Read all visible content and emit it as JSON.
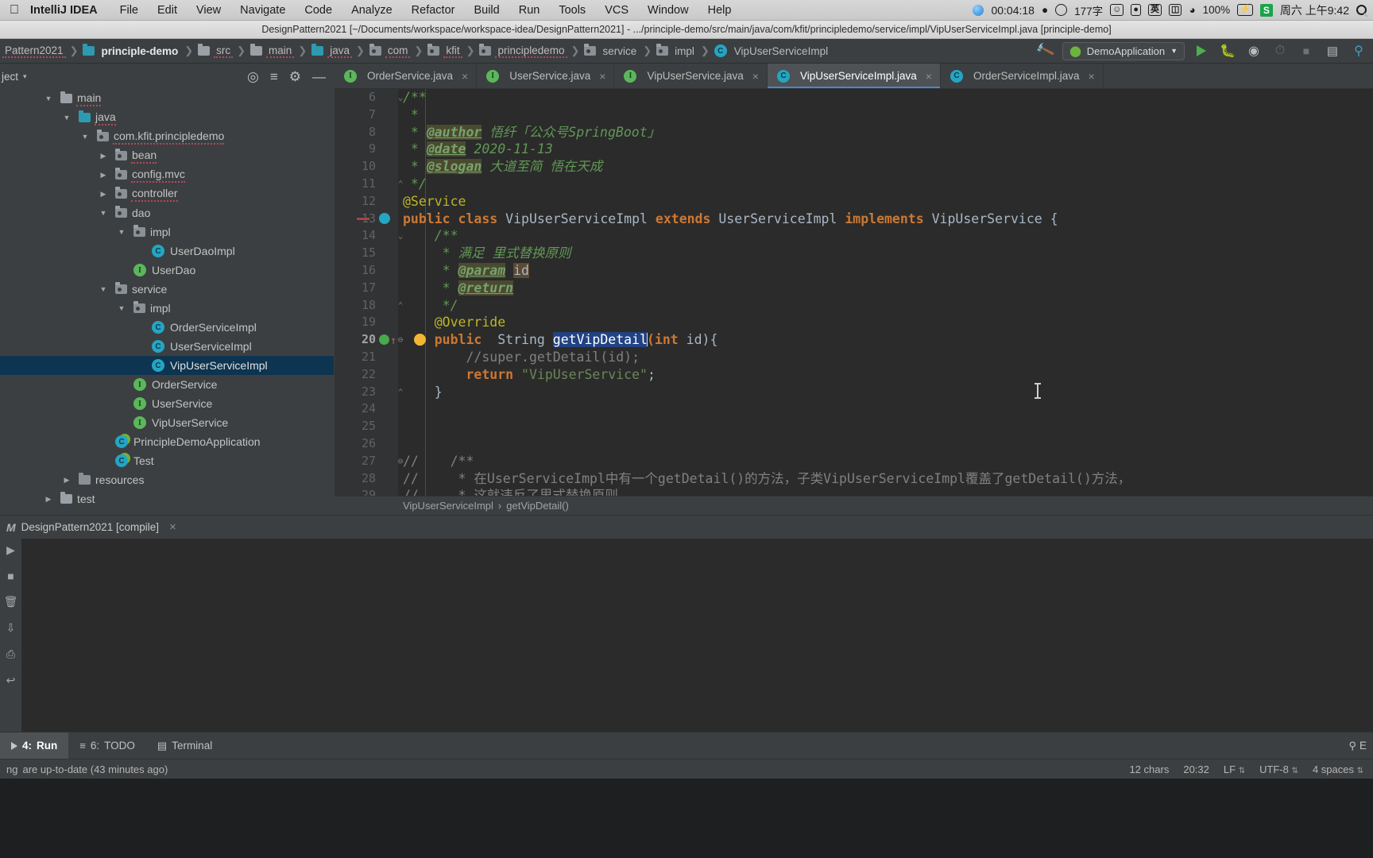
{
  "macbar": {
    "apple_glyph": "●",
    "app_name": "IntelliJ IDEA",
    "menus": [
      "File",
      "Edit",
      "View",
      "Navigate",
      "Code",
      "Analyze",
      "Refactor",
      "Build",
      "Run",
      "Tools",
      "VCS",
      "Window",
      "Help"
    ],
    "status_items": {
      "timer": "00:04:18",
      "char_count": "177字",
      "input_method": "英",
      "battery_percent": "100%",
      "clock": "周六 上午9:42",
      "shadowsocks": "S",
      "search_icon": "search-icon"
    }
  },
  "ide_title": "DesignPattern2021 [~/Documents/workspace/workspace-idea/DesignPattern2021] - .../principle-demo/src/main/java/com/kfit/principledemo/service/impl/VipUserServiceImpl.java [principle-demo]",
  "navbar": {
    "crumbs": [
      {
        "label": "Pattern2021",
        "icon": "none",
        "bold": false
      },
      {
        "label": "principle-demo",
        "icon": "module",
        "bold": true
      },
      {
        "label": "src",
        "icon": "folder",
        "bold": false
      },
      {
        "label": "main",
        "icon": "folder",
        "bold": false
      },
      {
        "label": "java",
        "icon": "folder-source",
        "bold": false
      },
      {
        "label": "com",
        "icon": "package",
        "bold": false
      },
      {
        "label": "kfit",
        "icon": "package",
        "bold": false
      },
      {
        "label": "principledemo",
        "icon": "package",
        "bold": false
      },
      {
        "label": "service",
        "icon": "package",
        "bold": false
      },
      {
        "label": "impl",
        "icon": "package",
        "bold": false
      },
      {
        "label": "VipUserServiceImpl",
        "icon": "class",
        "bold": false
      }
    ],
    "build_icon": "hammer-icon",
    "run_config": "DemoApplication",
    "run_config_caret": "▼",
    "buttons": [
      "run-icon",
      "debug-icon",
      "run-coverage-icon",
      "profiler-icon",
      "stop-icon",
      "layout-icon",
      "search-everywhere-icon"
    ]
  },
  "toolwindow": {
    "title": "ject",
    "caret": "▾",
    "icons": [
      "locate-icon",
      "collapse-all-icon",
      "settings-gear-icon",
      "hide-icon"
    ]
  },
  "tree": [
    {
      "label": "main",
      "depth": 2,
      "arrow": "▼",
      "icon": "folder",
      "selected": false,
      "squiggle": true
    },
    {
      "label": "java",
      "depth": 3,
      "arrow": "▼",
      "icon": "folder-source",
      "selected": false,
      "squiggle": true
    },
    {
      "label": "com.kfit.principledemo",
      "depth": 4,
      "arrow": "▼",
      "icon": "package",
      "selected": false,
      "squiggle": true
    },
    {
      "label": "bean",
      "depth": 5,
      "arrow": "▶",
      "icon": "package",
      "selected": false,
      "squiggle": true
    },
    {
      "label": "config.mvc",
      "depth": 5,
      "arrow": "▶",
      "icon": "package",
      "selected": false,
      "squiggle": true
    },
    {
      "label": "controller",
      "depth": 5,
      "arrow": "▶",
      "icon": "package",
      "selected": false,
      "squiggle": true
    },
    {
      "label": "dao",
      "depth": 5,
      "arrow": "▼",
      "icon": "package",
      "selected": false,
      "squiggle": false
    },
    {
      "label": "impl",
      "depth": 6,
      "arrow": "▼",
      "icon": "package",
      "selected": false,
      "squiggle": false
    },
    {
      "label": "UserDaoImpl",
      "depth": 7,
      "arrow": "",
      "icon": "class",
      "selected": false,
      "squiggle": false
    },
    {
      "label": "UserDao",
      "depth": 6,
      "arrow": "",
      "icon": "interface",
      "selected": false,
      "squiggle": false
    },
    {
      "label": "service",
      "depth": 5,
      "arrow": "▼",
      "icon": "package",
      "selected": false,
      "squiggle": false
    },
    {
      "label": "impl",
      "depth": 6,
      "arrow": "▼",
      "icon": "package",
      "selected": false,
      "squiggle": false
    },
    {
      "label": "OrderServiceImpl",
      "depth": 7,
      "arrow": "",
      "icon": "class",
      "selected": false,
      "squiggle": false
    },
    {
      "label": "UserServiceImpl",
      "depth": 7,
      "arrow": "",
      "icon": "class",
      "selected": false,
      "squiggle": false
    },
    {
      "label": "VipUserServiceImpl",
      "depth": 7,
      "arrow": "",
      "icon": "class",
      "selected": true,
      "squiggle": false
    },
    {
      "label": "OrderService",
      "depth": 6,
      "arrow": "",
      "icon": "interface",
      "selected": false,
      "squiggle": false
    },
    {
      "label": "UserService",
      "depth": 6,
      "arrow": "",
      "icon": "interface",
      "selected": false,
      "squiggle": false
    },
    {
      "label": "VipUserService",
      "depth": 6,
      "arrow": "",
      "icon": "interface",
      "selected": false,
      "squiggle": false
    },
    {
      "label": "PrincipleDemoApplication",
      "depth": 5,
      "arrow": "",
      "icon": "spring-class",
      "selected": false,
      "squiggle": false
    },
    {
      "label": "Test",
      "depth": 5,
      "arrow": "",
      "icon": "runnable-class",
      "selected": false,
      "squiggle": false
    },
    {
      "label": "resources",
      "depth": 3,
      "arrow": "▶",
      "icon": "folder-resource",
      "selected": false,
      "squiggle": false
    },
    {
      "label": "test",
      "depth": 2,
      "arrow": "▶",
      "icon": "folder",
      "selected": false,
      "squiggle": false
    }
  ],
  "tabs": [
    {
      "label": "OrderService.java",
      "icon": "interface",
      "active": false,
      "close": "×"
    },
    {
      "label": "UserService.java",
      "icon": "interface",
      "active": false,
      "close": "×"
    },
    {
      "label": "VipUserService.java",
      "icon": "interface",
      "active": false,
      "close": "×"
    },
    {
      "label": "VipUserServiceImpl.java",
      "icon": "class",
      "active": true,
      "close": "×"
    },
    {
      "label": "OrderServiceImpl.java",
      "icon": "class",
      "active": false,
      "close": "×"
    }
  ],
  "editor": {
    "first_line": 6,
    "lines": [
      {
        "n": 6,
        "text": "/**",
        "kind": "comment-partial"
      },
      {
        "n": 7,
        "text": " *",
        "kind": "comment"
      },
      {
        "n": 8,
        "text": " * @author 悟纤「公众号SpringBoot」",
        "kind": "javadoc-author"
      },
      {
        "n": 9,
        "text": " * @date 2020-11-13",
        "kind": "javadoc-date"
      },
      {
        "n": 10,
        "text": " * @slogan 大道至简 悟在天成",
        "kind": "javadoc-slogan"
      },
      {
        "n": 11,
        "text": " */",
        "kind": "comment"
      },
      {
        "n": 12,
        "text": "@Service",
        "kind": "annotation"
      },
      {
        "n": 13,
        "text": "public class VipUserServiceImpl extends UserServiceImpl implements VipUserService {",
        "kind": "class-decl"
      },
      {
        "n": 14,
        "text": "    /**",
        "kind": "comment"
      },
      {
        "n": 15,
        "text": "     * 满足 里式替换原则",
        "kind": "comment"
      },
      {
        "n": 16,
        "text": "     * @param id",
        "kind": "javadoc-param"
      },
      {
        "n": 17,
        "text": "     * @return",
        "kind": "javadoc-return"
      },
      {
        "n": 18,
        "text": "     */",
        "kind": "comment"
      },
      {
        "n": 19,
        "text": "    @Override",
        "kind": "annotation"
      },
      {
        "n": 20,
        "text": "    public  String getVipDetail(int id){",
        "kind": "method-decl"
      },
      {
        "n": 21,
        "text": "        //super.getDetail(id);",
        "kind": "line-comment"
      },
      {
        "n": 22,
        "text": "        return \"VipUserService\";",
        "kind": "return-stmt"
      },
      {
        "n": 23,
        "text": "    }",
        "kind": "plain"
      },
      {
        "n": 24,
        "text": "",
        "kind": "plain"
      },
      {
        "n": 25,
        "text": "",
        "kind": "plain"
      },
      {
        "n": 26,
        "text": "",
        "kind": "plain"
      },
      {
        "n": 27,
        "text": "//    /**",
        "kind": "line-comment"
      },
      {
        "n": 28,
        "text": "//     * 在UserServiceImpl中有一个getDetail()的方法，子类VipUserServiceImpl覆盖了getDetail()方法，",
        "kind": "line-comment"
      },
      {
        "n": 29,
        "text": "//     * 这就违反了里式替换原则。",
        "kind": "line-comment"
      }
    ],
    "selected_token": "getVipDetail",
    "current_line": 20
  },
  "editor_breadcrumb": {
    "class": "VipUserServiceImpl",
    "separator": "›",
    "method": "getVipDetail()"
  },
  "run_toolwindow": {
    "icon": "module-icon",
    "title": "DesignPattern2021 [compile]",
    "close": "×"
  },
  "bottom_bar": {
    "run": {
      "num": "4:",
      "label": "Run",
      "icon": "run-icon"
    },
    "todo": {
      "num": "6:",
      "label": "TODO",
      "icon": "todo-icon"
    },
    "terminal": {
      "label": "Terminal",
      "icon": "terminal-icon"
    }
  },
  "status_bar": {
    "message": "are up-to-date (43 minutes ago)",
    "left_truncated": "ng",
    "chars": "12 chars",
    "caret_position": "20:32",
    "line_separator": "LF",
    "encoding": "UTF-8",
    "indent": "4 spaces",
    "event_log": "E",
    "caret_glyph": "⇅"
  },
  "colors": {
    "background": "#3c3f41",
    "editor_bg": "#2b2b2b",
    "selection_blue": "#214283",
    "tree_selection": "#0d3450",
    "accent_teal": "#25a5c4",
    "accent_green": "#5bb75b",
    "keyword_orange": "#cc7832",
    "comment_green": "#629755",
    "string_green": "#6a8759",
    "annotation_yellow": "#bbb529",
    "tab_active": "#4e5254",
    "tab_underline": "#4a88c7"
  }
}
